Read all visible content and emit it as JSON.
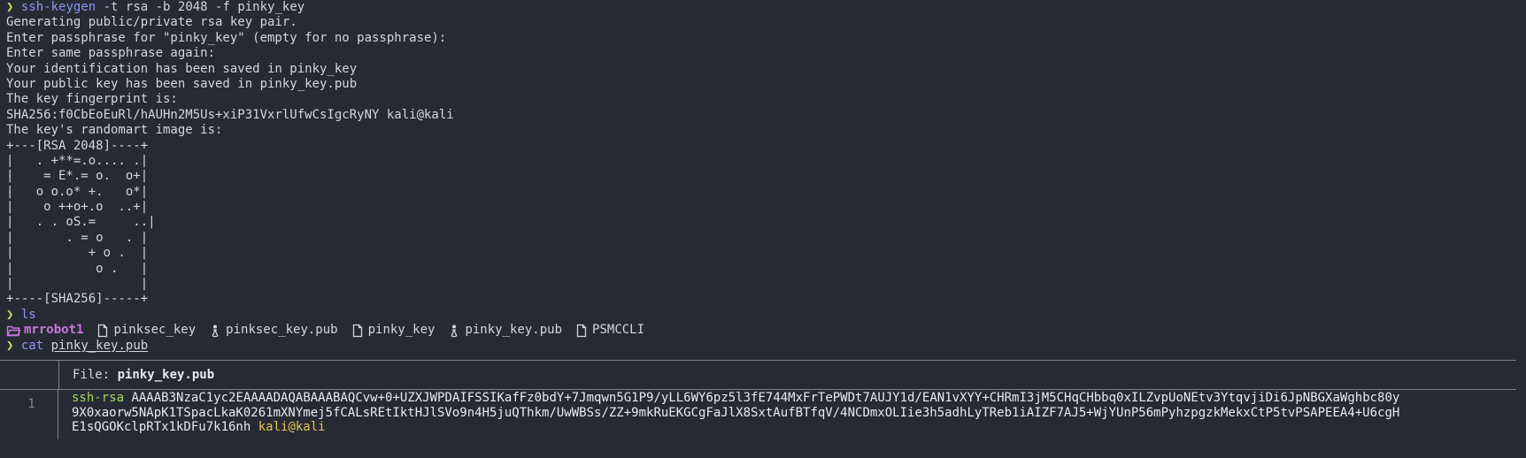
{
  "prompt_symbol": "❯",
  "session": {
    "cmd1": {
      "name": "ssh-keygen",
      "args": " -t rsa -b 2048 -f pinky_key"
    },
    "keygen_output": [
      "Generating public/private rsa key pair.",
      "Enter passphrase for \"pinky_key\" (empty for no passphrase):",
      "Enter same passphrase again:",
      "Your identification has been saved in pinky_key",
      "Your public key has been saved in pinky_key.pub",
      "The key fingerprint is:",
      "SHA256:f0CbEoEuRl/hAUHn2M5Us+xiP31VxrlUfwCsIgcRyNY kali@kali",
      "The key's randomart image is:",
      "+---[RSA 2048]----+",
      "|   . +**=.o.... .|",
      "|    = E*.= o.  o+|",
      "|   o o.o* +.   o*|",
      "|    o ++o+.o  ..+|",
      "|   . . oS.=     ..|",
      "|       . = o   . |",
      "|          + o .  |",
      "|           o .   |",
      "|                 |",
      "+----[SHA256]-----+"
    ],
    "cmd2": {
      "name": "ls",
      "args": ""
    },
    "ls_entries": [
      {
        "name": "mrrobot1",
        "icon": "folder-icon",
        "kind": "dir"
      },
      {
        "name": "pinksec_key",
        "icon": "file-icon",
        "kind": "file"
      },
      {
        "name": "pinksec_key.pub",
        "icon": "key-person-icon",
        "kind": "pub"
      },
      {
        "name": "pinky_key",
        "icon": "file-icon",
        "kind": "file"
      },
      {
        "name": "pinky_key.pub",
        "icon": "key-person-icon",
        "kind": "pub"
      },
      {
        "name": "PSMCCLI",
        "icon": "file-icon",
        "kind": "file"
      }
    ],
    "cmd3": {
      "name": "cat",
      "arg": "pinky_key.pub"
    }
  },
  "viewer": {
    "file_label": "File: ",
    "file_name": "pinky_key.pub",
    "line_number": "1",
    "key_type": "ssh-rsa",
    "key_lines": [
      "AAAAB3NzaC1yc2EAAAADAQABAAABAQCvw+0+UZXJWPDAIFSSIKafFz0bdY+7Jmqwn5G1P9/yLL6WY6pz5l3fE744MxFrTePWDt7AUJY1d/EAN1vXYY+CHRmI3jM5CHqCHbbq0xILZvpUoNEtv3YtqvjiDi6JpNBGXaWghbc80y",
      "9X0xaorw5NApK1TSpacLkaK0261mXNYmej5fCALsREtIktHJlSVo9n4H5juQThkm/UwWBSs/ZZ+9mkRuEKGCgFaJlX8SxtAufBTfqV/4NCDmxOLIie3h5adhLyTReb1iAIZF7AJ5+WjYUnP56mPyhzpgzkMekxCtP5tvPSAPEEA4+U6cgH",
      "E1sQGOKclpRTx1kDFu7k16nh"
    ],
    "key_comment": "kali@kali"
  },
  "colors": {
    "background": "#272a34",
    "prompt": "#c4e35a",
    "command": "#8f95f0",
    "directory": "#c678dd",
    "key_type": "#a6d85c",
    "comment": "#e6c34f"
  }
}
